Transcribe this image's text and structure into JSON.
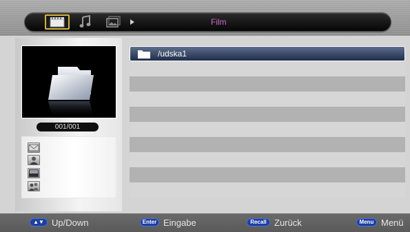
{
  "header": {
    "title": "Film",
    "tabs": [
      {
        "name": "film",
        "icon": "film-icon",
        "active": true
      },
      {
        "name": "music",
        "icon": "music-note-icon",
        "active": false
      },
      {
        "name": "photo",
        "icon": "photo-icon",
        "active": false
      }
    ]
  },
  "sidebar": {
    "counter": "001/001",
    "media_icons": [
      "mail-icon",
      "person-icon",
      "image-icon",
      "users-icon"
    ]
  },
  "file_list": {
    "items": [
      {
        "name": "/udska1",
        "type": "folder",
        "selected": true
      }
    ],
    "row_count": 10
  },
  "footer": {
    "hints": [
      {
        "key": "▲▼",
        "label": "Up/Down"
      },
      {
        "key": "Enter",
        "label": "Eingabe"
      },
      {
        "key": "Recall",
        "label": "Zurück"
      },
      {
        "key": "Menu",
        "label": "Menü"
      }
    ]
  },
  "colors": {
    "accent_title": "#cc66cc",
    "selection": "#1e2d4a",
    "key_button": "#1c3fa0",
    "active_tab_border": "#d6b33e"
  }
}
